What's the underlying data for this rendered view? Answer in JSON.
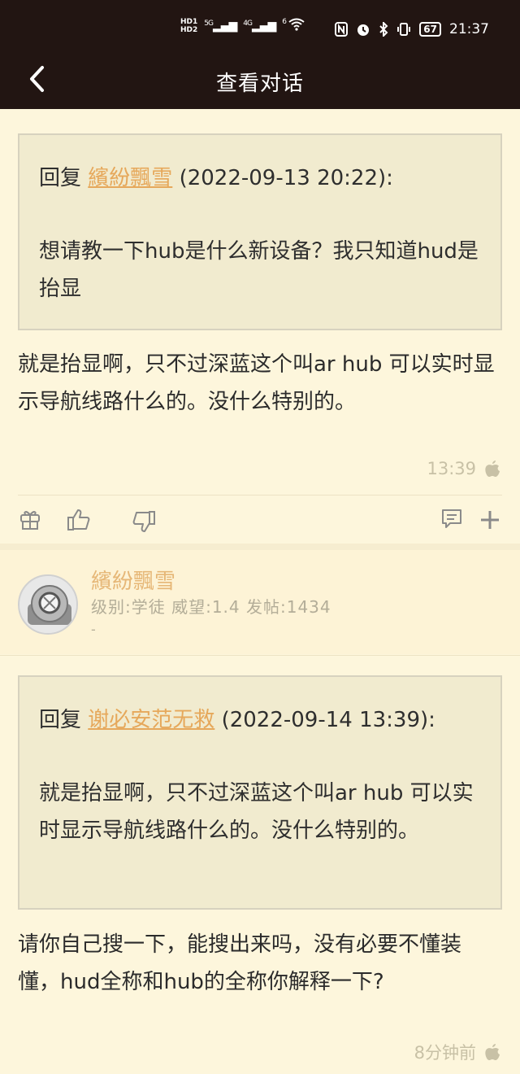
{
  "status_bar": {
    "hd_top": "HD1",
    "hd_bottom": "HD2",
    "sig1": "5G",
    "sig2": "4G",
    "sig3": "6",
    "battery": "67",
    "time": "21:37"
  },
  "header": {
    "title": "查看对话"
  },
  "posts": [
    {
      "quote": {
        "prefix": "回复",
        "user": "繽紛飄雪",
        "date": "(2022-09-13 20:22):",
        "body": "想请教一下hub是什么新设备？我只知道hud是抬显"
      },
      "reply": "就是抬显啊，只不过深蓝这个叫ar hub 可以实时显示导航线路什么的。没什么特别的。",
      "time": "13:39"
    },
    {
      "author": {
        "name": "繽紛飄雪",
        "stats": "级别:学徒  威望:1.4  发帖:1434",
        "dash": "-"
      },
      "quote": {
        "prefix": "回复",
        "user": "谢必安范无救",
        "date": "(2022-09-14 13:39):",
        "body": "就是抬显啊，只不过深蓝这个叫ar hub 可以实时显示导航线路什么的。没什么特别的。"
      },
      "reply": "请你自己搜一下，能搜出来吗，没有必要不懂装懂，hud全称和hub的全称你解释一下?",
      "time": "8分钟前"
    }
  ],
  "colors": {
    "topbar": "#221512",
    "background": "#fdf6dc",
    "quote_bg": "#f1ebcf",
    "username": "#e6a85b",
    "meta": "#c8c1a6"
  }
}
